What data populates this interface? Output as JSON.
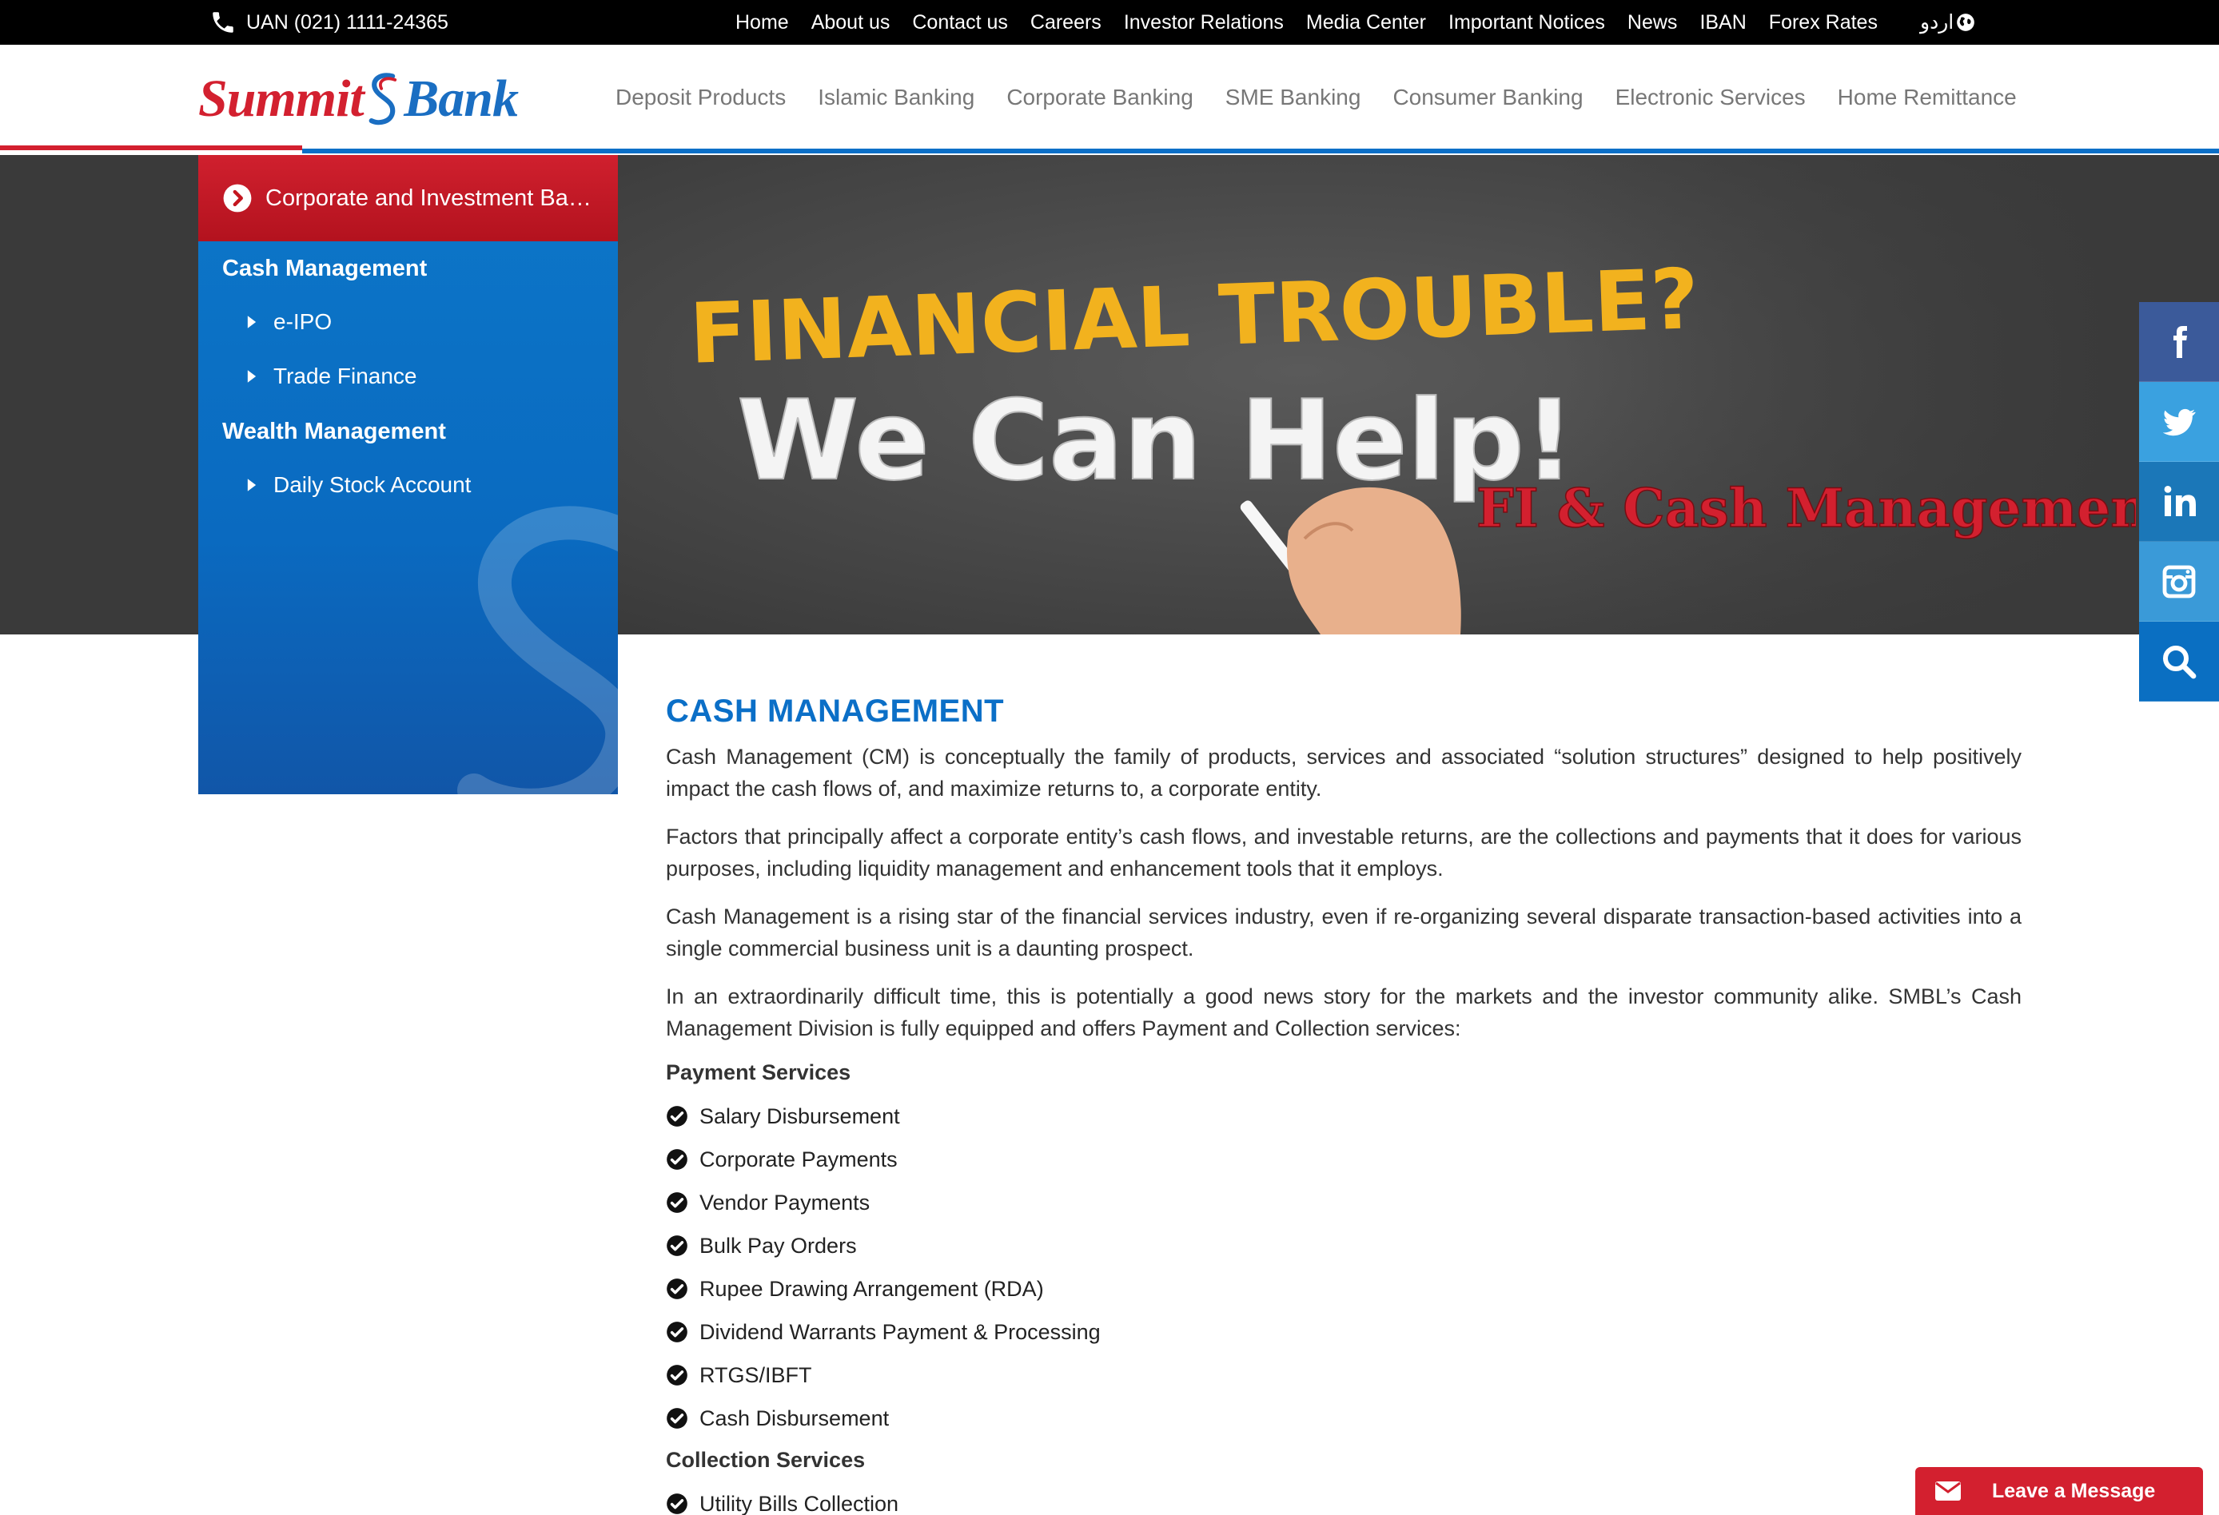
{
  "topbar": {
    "uan": "UAN (021) 1111-24365",
    "links": [
      "Home",
      "About us",
      "Contact us",
      "Careers",
      "Investor Relations",
      "Media Center",
      "Important Notices",
      "News",
      "IBAN",
      "Forex Rates"
    ],
    "language": "اردو"
  },
  "logo": {
    "part1": "Summit",
    "part2": "Bank"
  },
  "mainnav": [
    "Deposit Products",
    "Islamic Banking",
    "Corporate Banking",
    "SME Banking",
    "Consumer Banking",
    "Electronic Services",
    "Home Remittance"
  ],
  "banner": {
    "line1": "FINANCIAL TROUBLE?",
    "line2": "We Can Help!",
    "line3": "FI & Cash Management"
  },
  "sidebar": {
    "header": "Corporate and Investment Banking",
    "sections": [
      {
        "title": "Cash Management",
        "items": [
          "e-IPO",
          "Trade Finance"
        ]
      },
      {
        "title": "Wealth Management",
        "items": [
          "Daily Stock Account"
        ]
      }
    ]
  },
  "social": [
    "facebook-icon",
    "twitter-icon",
    "linkedin-icon",
    "instagram-icon",
    "search-icon"
  ],
  "colors": {
    "red": "#d3202f",
    "blue": "#0b6fc7",
    "topbar": "#000000"
  },
  "content": {
    "title": "CASH MANAGEMENT",
    "paragraphs": [
      "Cash Management (CM) is conceptually the family of products, services and associated “solution structures” designed to help positively impact the cash flows of, and maximize returns to, a corporate entity.",
      "Factors that principally affect a corporate entity’s cash flows, and investable returns, are the collections and payments that it does for various purposes, including liquidity management and enhancement tools that it employs.",
      "Cash Management is a rising star of the financial services industry, even if re-organizing several disparate transaction-based activities into a single commercial business unit is a daunting prospect.",
      "In an extraordinarily difficult time, this is potentially a good news story for the markets and the investor community alike. SMBL’s Cash Management Division is fully equipped and offers Payment and Collection services:"
    ],
    "payment_heading": "Payment Services",
    "payment_items": [
      "Salary Disbursement",
      "Corporate Payments",
      "Vendor Payments",
      "Bulk Pay Orders",
      "Rupee Drawing Arrangement (RDA)",
      "Dividend Warrants Payment & Processing",
      "RTGS/IBFT",
      "Cash Disbursement"
    ],
    "collection_heading": "Collection Services",
    "collection_items": [
      "Utility Bills Collection"
    ]
  },
  "leave_message": "Leave a Message"
}
